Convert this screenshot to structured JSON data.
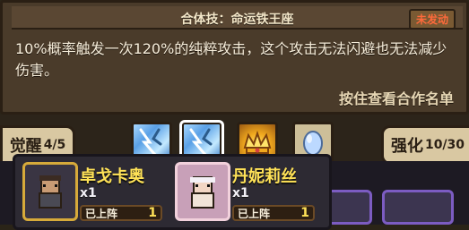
{
  "header": {
    "title": "合体技：命运铁王座",
    "badge": "未发动"
  },
  "description": "10%概率触发一次120%的纯粹攻击，这个攻击无法闪避也无法减少伤害。",
  "link_text": "按住查看合作名单",
  "awaken": {
    "label": "觉醒",
    "progress": "4/5"
  },
  "strengthen": {
    "label": "强化",
    "progress": "10/30"
  },
  "skills": [
    {
      "icon": "lightning-rune-icon"
    },
    {
      "icon": "lightning-rune-icon",
      "selected": true
    },
    {
      "icon": "crown-icon"
    },
    {
      "icon": "ice-crystal-icon"
    }
  ],
  "members": [
    {
      "name": "卓戈卡奥",
      "qty": "x1",
      "status": "已上阵",
      "count": "1"
    },
    {
      "name": "丹妮莉丝",
      "qty": "x1",
      "status": "已上阵",
      "count": "1"
    }
  ]
}
